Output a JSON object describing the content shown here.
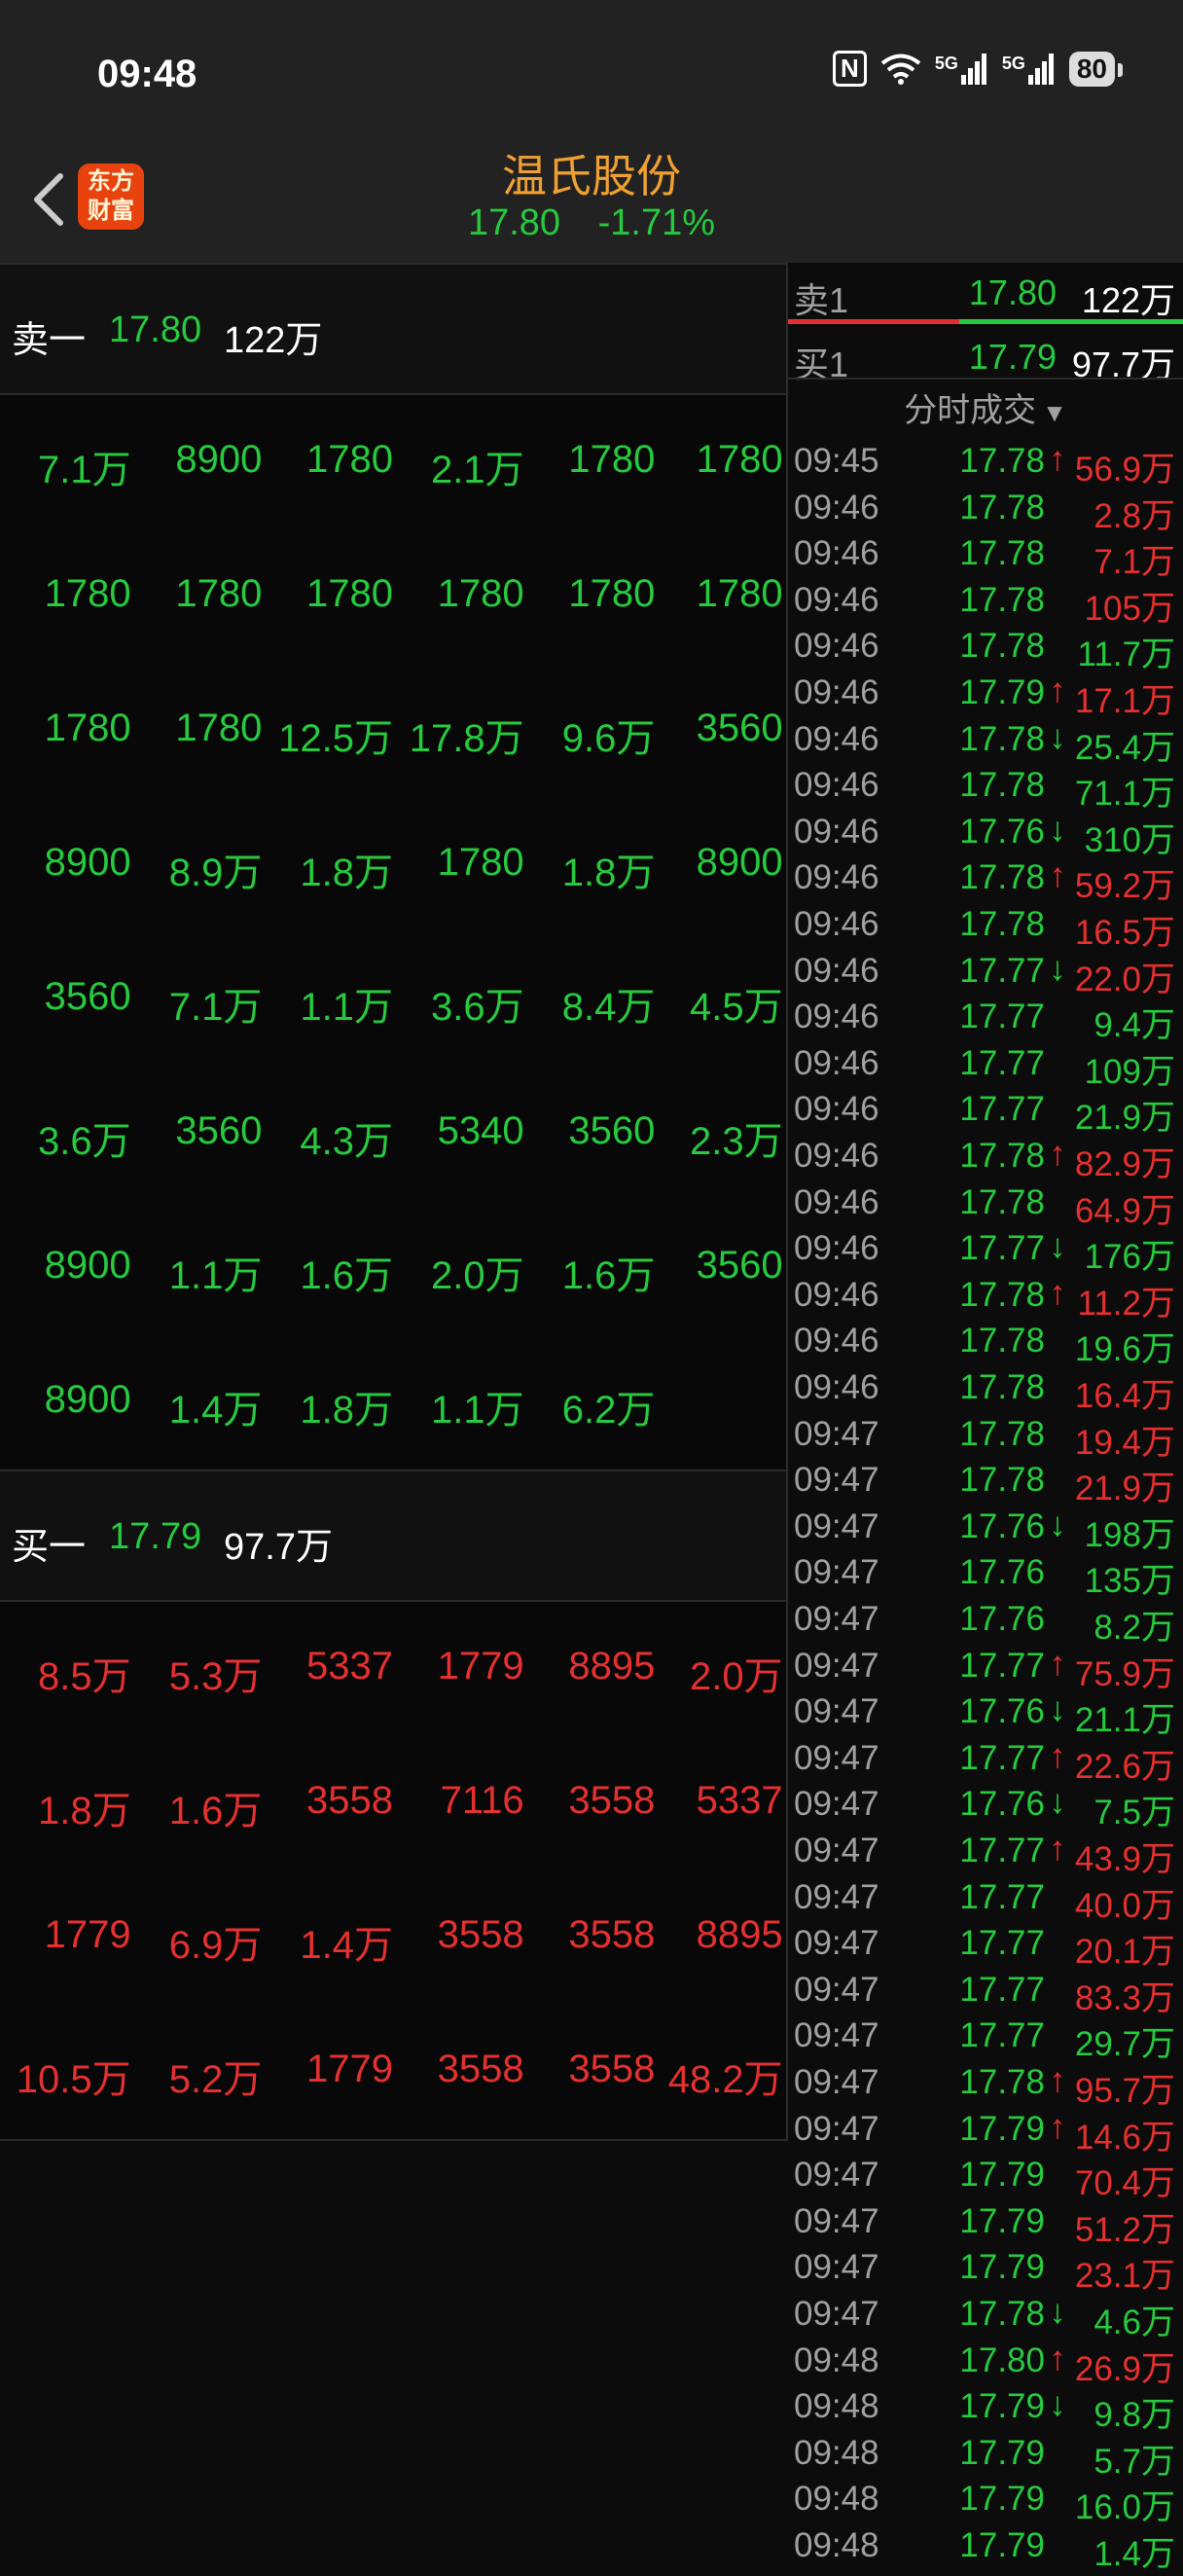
{
  "status": {
    "time": "09:48",
    "nfc": "N",
    "net1": "5G",
    "net2": "5G",
    "battery": "80"
  },
  "header": {
    "stock_name": "温氏股份",
    "price": "17.80",
    "change_pct": "-1.71%",
    "logo_line1": "东方",
    "logo_line2": "财富"
  },
  "sell_level": {
    "label": "卖一",
    "price": "17.80",
    "volume": "122万"
  },
  "buy_level": {
    "label": "买一",
    "price": "17.79",
    "volume": "97.7万"
  },
  "sell_queue": [
    [
      "7.1万",
      "8900",
      "1780",
      "2.1万",
      "1780",
      "1780"
    ],
    [
      "1780",
      "1780",
      "1780",
      "1780",
      "1780",
      "1780"
    ],
    [
      "1780",
      "1780",
      "12.5万",
      "17.8万",
      "9.6万",
      "3560"
    ],
    [
      "8900",
      "8.9万",
      "1.8万",
      "1780",
      "1.8万",
      "8900"
    ],
    [
      "3560",
      "7.1万",
      "1.1万",
      "3.6万",
      "8.4万",
      "4.5万"
    ],
    [
      "3.6万",
      "3560",
      "4.3万",
      "5340",
      "3560",
      "2.3万"
    ],
    [
      "8900",
      "1.1万",
      "1.6万",
      "2.0万",
      "1.6万",
      "3560"
    ],
    [
      "8900",
      "1.4万",
      "1.8万",
      "1.1万",
      "6.2万",
      ""
    ]
  ],
  "buy_queue": [
    [
      "8.5万",
      "5.3万",
      "5337",
      "1779",
      "8895",
      "2.0万"
    ],
    [
      "1.8万",
      "1.6万",
      "3558",
      "7116",
      "3558",
      "5337"
    ],
    [
      "1779",
      "6.9万",
      "1.4万",
      "3558",
      "3558",
      "8895"
    ],
    [
      "10.5万",
      "5.2万",
      "1779",
      "3558",
      "3558",
      "48.2万"
    ]
  ],
  "order_book": {
    "ask": {
      "label": "卖1",
      "price": "17.80",
      "volume": "122万"
    },
    "bid": {
      "label": "买1",
      "price": "17.79",
      "volume": "97.7万"
    }
  },
  "trades_title": "分时成交",
  "colors": {
    "up": "#e53030",
    "down": "#27c93f",
    "title": "#f0a030"
  },
  "trades": [
    {
      "time": "09:45",
      "price": "17.78",
      "dir": "↑",
      "vol": "56.9万",
      "pc": "down",
      "vc": "up"
    },
    {
      "time": "09:46",
      "price": "17.78",
      "dir": "",
      "vol": "2.8万",
      "pc": "down",
      "vc": "up"
    },
    {
      "time": "09:46",
      "price": "17.78",
      "dir": "",
      "vol": "7.1万",
      "pc": "down",
      "vc": "up"
    },
    {
      "time": "09:46",
      "price": "17.78",
      "dir": "",
      "vol": "105万",
      "pc": "down",
      "vc": "up"
    },
    {
      "time": "09:46",
      "price": "17.78",
      "dir": "",
      "vol": "11.7万",
      "pc": "down",
      "vc": "down"
    },
    {
      "time": "09:46",
      "price": "17.79",
      "dir": "↑",
      "vol": "17.1万",
      "pc": "down",
      "vc": "up"
    },
    {
      "time": "09:46",
      "price": "17.78",
      "dir": "↓",
      "vol": "25.4万",
      "pc": "down",
      "vc": "down"
    },
    {
      "time": "09:46",
      "price": "17.78",
      "dir": "",
      "vol": "71.1万",
      "pc": "down",
      "vc": "down"
    },
    {
      "time": "09:46",
      "price": "17.76",
      "dir": "↓",
      "vol": "310万",
      "pc": "down",
      "vc": "down"
    },
    {
      "time": "09:46",
      "price": "17.78",
      "dir": "↑",
      "vol": "59.2万",
      "pc": "down",
      "vc": "up"
    },
    {
      "time": "09:46",
      "price": "17.78",
      "dir": "",
      "vol": "16.5万",
      "pc": "down",
      "vc": "up"
    },
    {
      "time": "09:46",
      "price": "17.77",
      "dir": "↓",
      "vol": "22.0万",
      "pc": "down",
      "vc": "up"
    },
    {
      "time": "09:46",
      "price": "17.77",
      "dir": "",
      "vol": "9.4万",
      "pc": "down",
      "vc": "down"
    },
    {
      "time": "09:46",
      "price": "17.77",
      "dir": "",
      "vol": "109万",
      "pc": "down",
      "vc": "down"
    },
    {
      "time": "09:46",
      "price": "17.77",
      "dir": "",
      "vol": "21.9万",
      "pc": "down",
      "vc": "down"
    },
    {
      "time": "09:46",
      "price": "17.78",
      "dir": "↑",
      "vol": "82.9万",
      "pc": "down",
      "vc": "up"
    },
    {
      "time": "09:46",
      "price": "17.78",
      "dir": "",
      "vol": "64.9万",
      "pc": "down",
      "vc": "up"
    },
    {
      "time": "09:46",
      "price": "17.77",
      "dir": "↓",
      "vol": "176万",
      "pc": "down",
      "vc": "down"
    },
    {
      "time": "09:46",
      "price": "17.78",
      "dir": "↑",
      "vol": "11.2万",
      "pc": "down",
      "vc": "up"
    },
    {
      "time": "09:46",
      "price": "17.78",
      "dir": "",
      "vol": "19.6万",
      "pc": "down",
      "vc": "down"
    },
    {
      "time": "09:46",
      "price": "17.78",
      "dir": "",
      "vol": "16.4万",
      "pc": "down",
      "vc": "up"
    },
    {
      "time": "09:47",
      "price": "17.78",
      "dir": "",
      "vol": "19.4万",
      "pc": "down",
      "vc": "up"
    },
    {
      "time": "09:47",
      "price": "17.78",
      "dir": "",
      "vol": "21.9万",
      "pc": "down",
      "vc": "up"
    },
    {
      "time": "09:47",
      "price": "17.76",
      "dir": "↓",
      "vol": "198万",
      "pc": "down",
      "vc": "down"
    },
    {
      "time": "09:47",
      "price": "17.76",
      "dir": "",
      "vol": "135万",
      "pc": "down",
      "vc": "down"
    },
    {
      "time": "09:47",
      "price": "17.76",
      "dir": "",
      "vol": "8.2万",
      "pc": "down",
      "vc": "down"
    },
    {
      "time": "09:47",
      "price": "17.77",
      "dir": "↑",
      "vol": "75.9万",
      "pc": "down",
      "vc": "up"
    },
    {
      "time": "09:47",
      "price": "17.76",
      "dir": "↓",
      "vol": "21.1万",
      "pc": "down",
      "vc": "down"
    },
    {
      "time": "09:47",
      "price": "17.77",
      "dir": "↑",
      "vol": "22.6万",
      "pc": "down",
      "vc": "up"
    },
    {
      "time": "09:47",
      "price": "17.76",
      "dir": "↓",
      "vol": "7.5万",
      "pc": "down",
      "vc": "down"
    },
    {
      "time": "09:47",
      "price": "17.77",
      "dir": "↑",
      "vol": "43.9万",
      "pc": "down",
      "vc": "up"
    },
    {
      "time": "09:47",
      "price": "17.77",
      "dir": "",
      "vol": "40.0万",
      "pc": "down",
      "vc": "up"
    },
    {
      "time": "09:47",
      "price": "17.77",
      "dir": "",
      "vol": "20.1万",
      "pc": "down",
      "vc": "up"
    },
    {
      "time": "09:47",
      "price": "17.77",
      "dir": "",
      "vol": "83.3万",
      "pc": "down",
      "vc": "up"
    },
    {
      "time": "09:47",
      "price": "17.77",
      "dir": "",
      "vol": "29.7万",
      "pc": "down",
      "vc": "down"
    },
    {
      "time": "09:47",
      "price": "17.78",
      "dir": "↑",
      "vol": "95.7万",
      "pc": "down",
      "vc": "up"
    },
    {
      "time": "09:47",
      "price": "17.79",
      "dir": "↑",
      "vol": "14.6万",
      "pc": "down",
      "vc": "up"
    },
    {
      "time": "09:47",
      "price": "17.79",
      "dir": "",
      "vol": "70.4万",
      "pc": "down",
      "vc": "up"
    },
    {
      "time": "09:47",
      "price": "17.79",
      "dir": "",
      "vol": "51.2万",
      "pc": "down",
      "vc": "up"
    },
    {
      "time": "09:47",
      "price": "17.79",
      "dir": "",
      "vol": "23.1万",
      "pc": "down",
      "vc": "up"
    },
    {
      "time": "09:47",
      "price": "17.78",
      "dir": "↓",
      "vol": "4.6万",
      "pc": "down",
      "vc": "down"
    },
    {
      "time": "09:48",
      "price": "17.80",
      "dir": "↑",
      "vol": "26.9万",
      "pc": "down",
      "vc": "up"
    },
    {
      "time": "09:48",
      "price": "17.79",
      "dir": "↓",
      "vol": "9.8万",
      "pc": "down",
      "vc": "down"
    },
    {
      "time": "09:48",
      "price": "17.79",
      "dir": "",
      "vol": "5.7万",
      "pc": "down",
      "vc": "down"
    },
    {
      "time": "09:48",
      "price": "17.79",
      "dir": "",
      "vol": "16.0万",
      "pc": "down",
      "vc": "down"
    },
    {
      "time": "09:48",
      "price": "17.79",
      "dir": "",
      "vol": "1.4万",
      "pc": "down",
      "vc": "down"
    }
  ]
}
